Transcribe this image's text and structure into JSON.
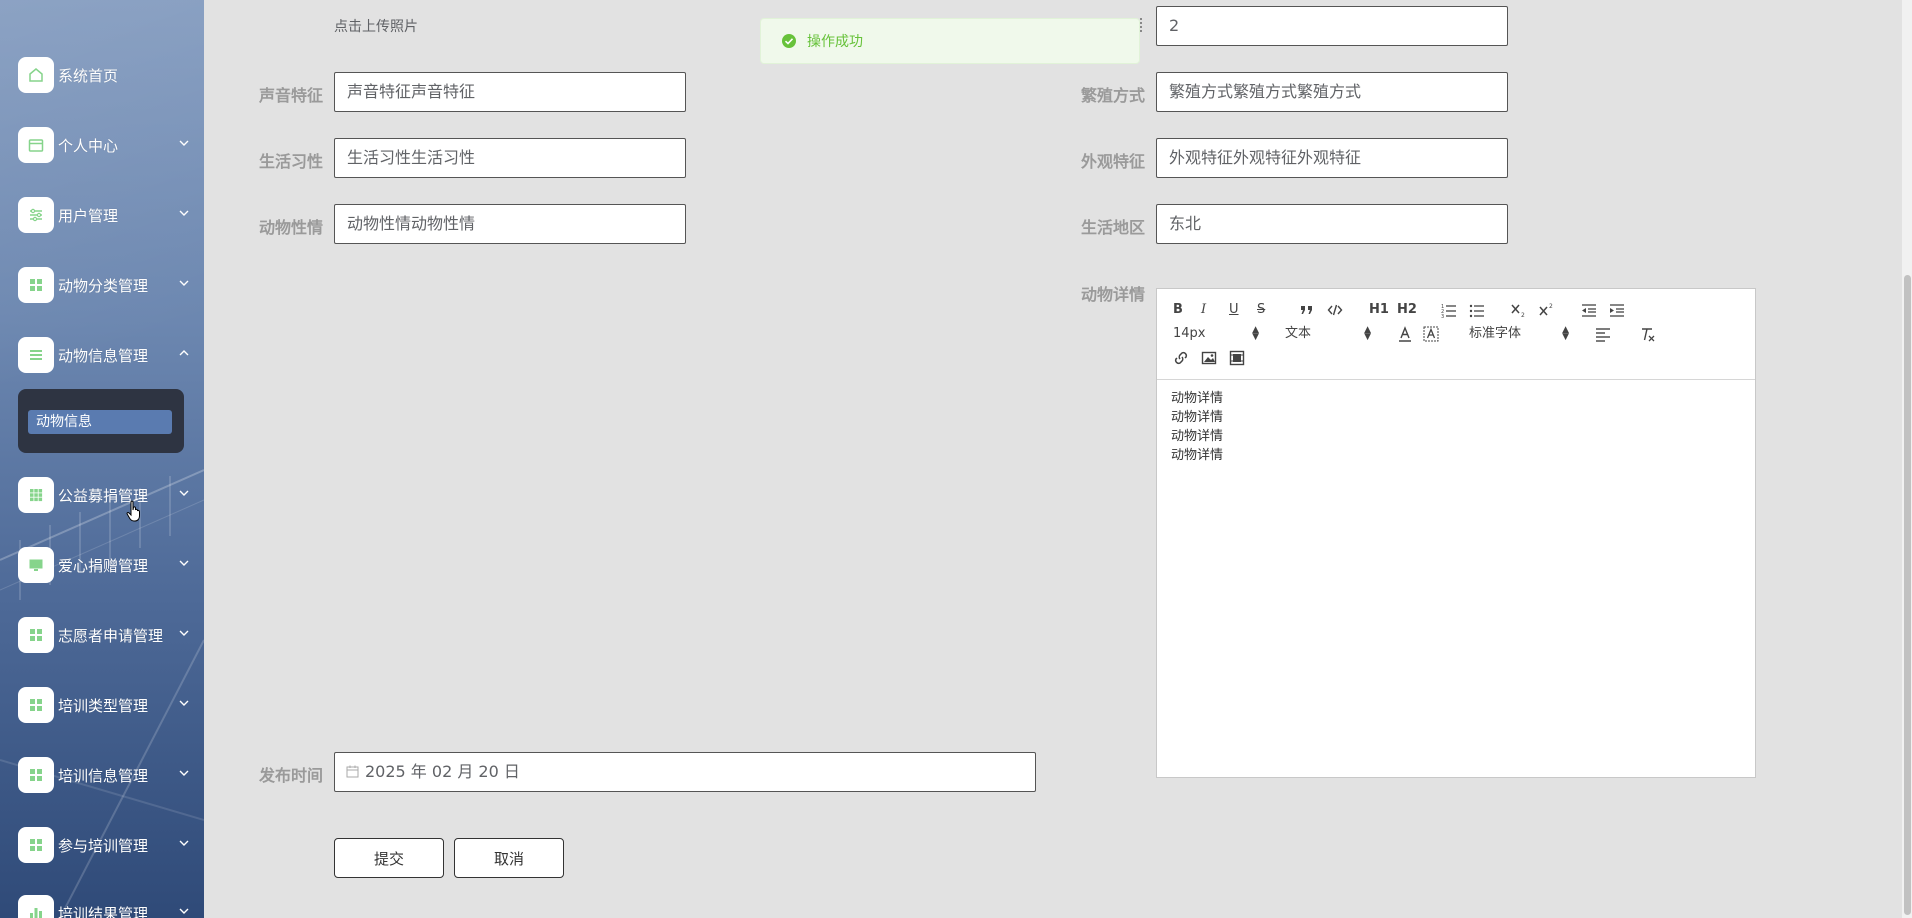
{
  "sidebar": {
    "items": [
      {
        "label": "系统首页",
        "icon": "home-icon",
        "has_children": false,
        "expanded": false
      },
      {
        "label": "个人中心",
        "icon": "calendar-icon",
        "has_children": true,
        "expanded": false
      },
      {
        "label": "用户管理",
        "icon": "sliders-icon",
        "has_children": true,
        "expanded": false
      },
      {
        "label": "动物分类管理",
        "icon": "grid-icon",
        "has_children": true,
        "expanded": false
      },
      {
        "label": "动物信息管理",
        "icon": "list-icon",
        "has_children": true,
        "expanded": true
      },
      {
        "label": "公益募捐管理",
        "icon": "apps-icon",
        "has_children": true,
        "expanded": false
      },
      {
        "label": "爱心捐赠管理",
        "icon": "monitor-icon",
        "has_children": true,
        "expanded": false
      },
      {
        "label": "志愿者申请管理",
        "icon": "grid-icon",
        "has_children": true,
        "expanded": false
      },
      {
        "label": "培训类型管理",
        "icon": "grid-icon",
        "has_children": true,
        "expanded": false
      },
      {
        "label": "培训信息管理",
        "icon": "grid-icon",
        "has_children": true,
        "expanded": false
      },
      {
        "label": "参与培训管理",
        "icon": "grid-icon",
        "has_children": true,
        "expanded": false
      },
      {
        "label": "培训结果管理",
        "icon": "bar-chart-icon",
        "has_children": true,
        "expanded": false
      }
    ],
    "submenu": {
      "label": "动物信息"
    },
    "accent_color": "#86d48b"
  },
  "toast": {
    "text": "操作成功",
    "color": "#67c23a"
  },
  "form": {
    "upload_hint": "点击上传照片",
    "top_right_value": "2",
    "voice": {
      "label": "声音特征",
      "value": "声音特征声音特征"
    },
    "breeding": {
      "label": "繁殖方式",
      "value": "繁殖方式繁殖方式繁殖方式"
    },
    "habits": {
      "label": "生活习性",
      "value": "生活习性生活习性"
    },
    "appearance": {
      "label": "外观特征",
      "value": "外观特征外观特征外观特征"
    },
    "temper": {
      "label": "动物性情",
      "value": "动物性情动物性情"
    },
    "region": {
      "label": "生活地区",
      "value": "东北"
    },
    "details": {
      "label": "动物详情",
      "lines": [
        "动物详情",
        "动物详情",
        "动物详情",
        "动物详情"
      ]
    },
    "publish_time": {
      "label": "发布时间",
      "value": "2025 年 02 月 20 日"
    },
    "submit_label": "提交",
    "cancel_label": "取消"
  },
  "editor_toolbar": {
    "bold": "B",
    "italic": "I",
    "underline": "U",
    "strike": "S",
    "h1": "H1",
    "h2": "H2",
    "size_value": "14px",
    "header_value": "文本",
    "font_value": "标准字体"
  }
}
